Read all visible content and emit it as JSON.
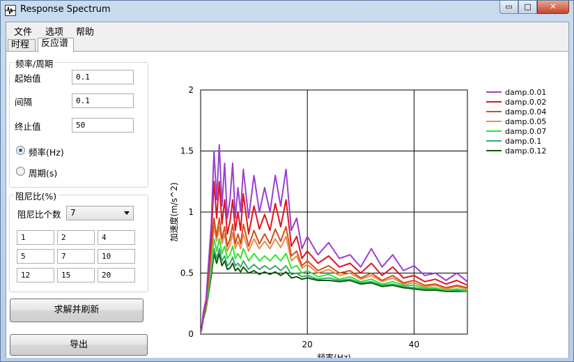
{
  "window": {
    "title": "Response Spectrum",
    "min_label": "▭",
    "max_label": "□",
    "close_label": "✕"
  },
  "menu": [
    "文件",
    "选项",
    "帮助"
  ],
  "tabs": [
    {
      "label": "时程",
      "active": false
    },
    {
      "label": "反应谱",
      "active": true
    }
  ],
  "freq_group": {
    "title": "频率/周期",
    "start_label": "起始值",
    "start_value": "0.1",
    "step_label": "间隔",
    "step_value": "0.1",
    "end_label": "终止值",
    "end_value": "50",
    "radio_freq": "频率(Hz)",
    "radio_period": "周期(s)",
    "selected": "freq"
  },
  "damp_group": {
    "title": "阻尼比(%)",
    "count_label": "阻尼比个数",
    "count_value": "7",
    "values": [
      "1",
      "2",
      "4",
      "5",
      "7",
      "10",
      "12",
      "15",
      "20"
    ]
  },
  "buttons": {
    "solve": "求解并刷新",
    "export": "导出"
  },
  "chart_data": {
    "type": "line",
    "xlabel": "频率(Hz)",
    "ylabel": "加速度(m/s^2)",
    "xlim": [
      0,
      50
    ],
    "ylim": [
      0,
      2
    ],
    "xticks": [
      "20",
      "40"
    ],
    "yticks": [
      "0",
      "0.5",
      "1",
      "1.5",
      "2"
    ],
    "grid": true,
    "legend_position": "right",
    "x": [
      0.1,
      0.5,
      1,
      2,
      2.5,
      3,
      3.5,
      4,
      4.5,
      5,
      5.5,
      6,
      6.5,
      7,
      7.5,
      8,
      9,
      10,
      11,
      12,
      13,
      14,
      15,
      16,
      17,
      18,
      19,
      20,
      22,
      24,
      26,
      28,
      30,
      32,
      34,
      36,
      38,
      40,
      42,
      44,
      46,
      48,
      50
    ],
    "series": [
      {
        "name": "damp.0.01",
        "color": "#9a3fd0",
        "values": [
          0.02,
          0.18,
          0.28,
          0.9,
          1.5,
          1.1,
          1.55,
          1.05,
          1.4,
          0.95,
          1.1,
          1.4,
          0.95,
          1.2,
          1.0,
          1.35,
          0.95,
          1.3,
          1.0,
          1.2,
          1.0,
          1.3,
          1.05,
          1.35,
          0.85,
          0.95,
          0.7,
          0.8,
          0.65,
          0.75,
          0.62,
          0.65,
          0.55,
          0.7,
          0.55,
          0.65,
          0.52,
          0.56,
          0.48,
          0.5,
          0.44,
          0.5,
          0.43
        ]
      },
      {
        "name": "damp.0.02",
        "color": "#e0141c",
        "values": [
          0.02,
          0.16,
          0.26,
          0.8,
          1.25,
          0.95,
          1.25,
          0.9,
          1.1,
          0.82,
          0.92,
          1.1,
          0.85,
          1.0,
          0.85,
          1.15,
          0.82,
          1.05,
          0.86,
          0.98,
          0.85,
          1.07,
          0.88,
          1.1,
          0.72,
          0.8,
          0.62,
          0.68,
          0.58,
          0.64,
          0.55,
          0.58,
          0.5,
          0.58,
          0.48,
          0.55,
          0.46,
          0.48,
          0.43,
          0.45,
          0.41,
          0.44,
          0.4
        ]
      },
      {
        "name": "damp.0.04",
        "color": "#d0501a",
        "values": [
          0.02,
          0.15,
          0.25,
          0.7,
          0.95,
          0.8,
          0.95,
          0.78,
          0.88,
          0.72,
          0.78,
          0.9,
          0.74,
          0.82,
          0.74,
          0.9,
          0.72,
          0.85,
          0.74,
          0.82,
          0.74,
          0.86,
          0.76,
          0.88,
          0.64,
          0.68,
          0.56,
          0.6,
          0.52,
          0.56,
          0.5,
          0.52,
          0.46,
          0.5,
          0.44,
          0.48,
          0.42,
          0.44,
          0.4,
          0.41,
          0.38,
          0.4,
          0.38
        ]
      },
      {
        "name": "damp.0.05",
        "color": "#ee8a50",
        "values": [
          0.02,
          0.15,
          0.24,
          0.66,
          0.88,
          0.76,
          0.88,
          0.74,
          0.82,
          0.68,
          0.73,
          0.83,
          0.7,
          0.76,
          0.7,
          0.82,
          0.68,
          0.78,
          0.7,
          0.76,
          0.7,
          0.78,
          0.71,
          0.8,
          0.6,
          0.64,
          0.54,
          0.57,
          0.5,
          0.53,
          0.48,
          0.5,
          0.45,
          0.48,
          0.43,
          0.46,
          0.41,
          0.42,
          0.39,
          0.4,
          0.37,
          0.39,
          0.37
        ]
      },
      {
        "name": "damp.0.07",
        "color": "#2ee82e",
        "values": [
          0.02,
          0.14,
          0.22,
          0.58,
          0.78,
          0.68,
          0.78,
          0.66,
          0.72,
          0.62,
          0.65,
          0.72,
          0.62,
          0.66,
          0.62,
          0.7,
          0.6,
          0.66,
          0.6,
          0.64,
          0.6,
          0.65,
          0.6,
          0.66,
          0.54,
          0.56,
          0.5,
          0.52,
          0.47,
          0.49,
          0.45,
          0.47,
          0.43,
          0.45,
          0.41,
          0.43,
          0.4,
          0.4,
          0.38,
          0.38,
          0.36,
          0.37,
          0.36
        ]
      },
      {
        "name": "damp.0.1",
        "color": "#3aa868",
        "values": [
          0.02,
          0.13,
          0.21,
          0.52,
          0.7,
          0.62,
          0.7,
          0.6,
          0.64,
          0.56,
          0.58,
          0.63,
          0.56,
          0.58,
          0.55,
          0.6,
          0.53,
          0.57,
          0.53,
          0.56,
          0.53,
          0.56,
          0.52,
          0.56,
          0.49,
          0.5,
          0.47,
          0.48,
          0.45,
          0.46,
          0.44,
          0.45,
          0.42,
          0.43,
          0.4,
          0.41,
          0.39,
          0.38,
          0.37,
          0.37,
          0.36,
          0.36,
          0.35
        ]
      },
      {
        "name": "damp.0.12",
        "color": "#0a5a0a",
        "values": [
          0.02,
          0.12,
          0.2,
          0.48,
          0.66,
          0.58,
          0.66,
          0.56,
          0.6,
          0.53,
          0.54,
          0.58,
          0.52,
          0.54,
          0.51,
          0.55,
          0.5,
          0.52,
          0.49,
          0.51,
          0.49,
          0.51,
          0.48,
          0.51,
          0.46,
          0.47,
          0.45,
          0.46,
          0.44,
          0.44,
          0.43,
          0.44,
          0.41,
          0.42,
          0.39,
          0.4,
          0.38,
          0.37,
          0.36,
          0.36,
          0.35,
          0.35,
          0.35
        ]
      }
    ]
  }
}
